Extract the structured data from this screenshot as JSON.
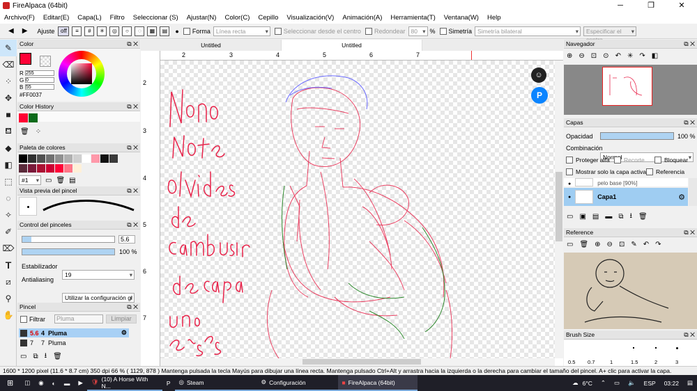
{
  "window": {
    "title": "FireAlpaca (64bit)",
    "minimize": "─",
    "maximize": "❐",
    "close": "✕"
  },
  "menu": [
    "Archivo(F)",
    "Editar(E)",
    "Capa(L)",
    "Filtro",
    "Seleccionar (S)",
    "Ajustar(N)",
    "Color(C)",
    "Cepillo",
    "Visualización(V)",
    "Animación(A)",
    "Herramienta(T)",
    "Ventana(W)",
    "Help"
  ],
  "toolbar": {
    "ajuste": "Ajuste",
    "off": "off",
    "forma": "Forma",
    "forma_value": "Línea recta",
    "select_center": "Seleccionar desde el centro",
    "redondear": "Redondear",
    "redondear_value": "80",
    "percent": "%",
    "simetria": "Simetría",
    "simetria_value": "Simetría bilateral",
    "specify_center": "Especificar el centro"
  },
  "color_panel": {
    "title": "Color",
    "r_label": "R",
    "r": "255",
    "g_label": "G",
    "g": "0",
    "b_label": "B",
    "b": "55",
    "hex": "#FF0037",
    "accent": "#ff0037"
  },
  "color_history": {
    "title": "Color History",
    "swatches": [
      "#ff0033",
      "#0b6b1a"
    ]
  },
  "palette": {
    "title": "Paleta de colores",
    "set": "#1",
    "swatches": [
      "#000000",
      "#303030",
      "#505050",
      "#707070",
      "#909090",
      "#b0b0b0",
      "#d0d0d0",
      "#ffffff",
      "#ff99aa",
      "#111111",
      "#3a3a3a",
      "#5a2a3a",
      "#7a1a3a",
      "#aa1133",
      "#cc0033",
      "#ff0037",
      "#ff7788",
      "#fff0d8"
    ]
  },
  "brush_preview": {
    "title": "Vista previa del pincel"
  },
  "brush_control": {
    "title": "Control del pinceles",
    "size": "5.6",
    "opacity": "100 %",
    "stabilizer_label": "Estabilizador",
    "stabilizer_value": "19",
    "antialias_label": "Antialiasing",
    "antialias_value": "Utilizar la configuración gl"
  },
  "brush_list": {
    "title": "Pincel",
    "filter": "Filtrar",
    "filter_placeholder": "Pluma",
    "clear": "Limpiar",
    "items": [
      {
        "size": "5.6",
        "name": "Pluma",
        "num": "4"
      },
      {
        "size": "7",
        "name": "Pluma",
        "num": "7"
      }
    ]
  },
  "tabs": [
    "Untitled",
    "Untitled"
  ],
  "ruler_h": [
    "2",
    "3",
    "4",
    "5",
    "6",
    "7"
  ],
  "ruler_v": [
    "2",
    "3",
    "4",
    "5",
    "6",
    "7"
  ],
  "navigator": {
    "title": "Navegador"
  },
  "layers": {
    "title": "Capas",
    "opacity_label": "Opacidad",
    "opacity": "100 %",
    "opacity_value": 1.0,
    "blend_label": "Combinación",
    "blend_value": "Normal",
    "protect_alpha": "Proteger alfa",
    "clip": "Recorte",
    "lock": "Bloquear",
    "show_active": "Mostrar solo la capa activa",
    "reference": "Referencia",
    "items": [
      {
        "name": "pelo base [90%]"
      },
      {
        "name": "Capa1"
      }
    ]
  },
  "reference": {
    "title": "Reference"
  },
  "brush_size": {
    "title": "Brush Size",
    "sizes": [
      "0.5",
      "0.7",
      "1",
      "1.5",
      "2",
      "3"
    ]
  },
  "status": {
    "text": "1600 * 1200 pixel   (11.6 * 8.7 cm)   350 dpi   66 %   ( 1129, 878 )   Mantenga pulsada la tecla Mayús para dibujar una línea recta. Mantenga pulsado Ctrl+Alt y arrastra hacia la izquierda o la derecha para cambiar el tamaño del pincel. A+ clic para activar la capa."
  },
  "taskbar": {
    "items": [
      "(10) A Horse With N...",
      "Steam",
      "Configuración",
      "FireAlpaca (64bit)"
    ],
    "weather": "6°C",
    "lang": "ESP",
    "time": "03:22"
  }
}
